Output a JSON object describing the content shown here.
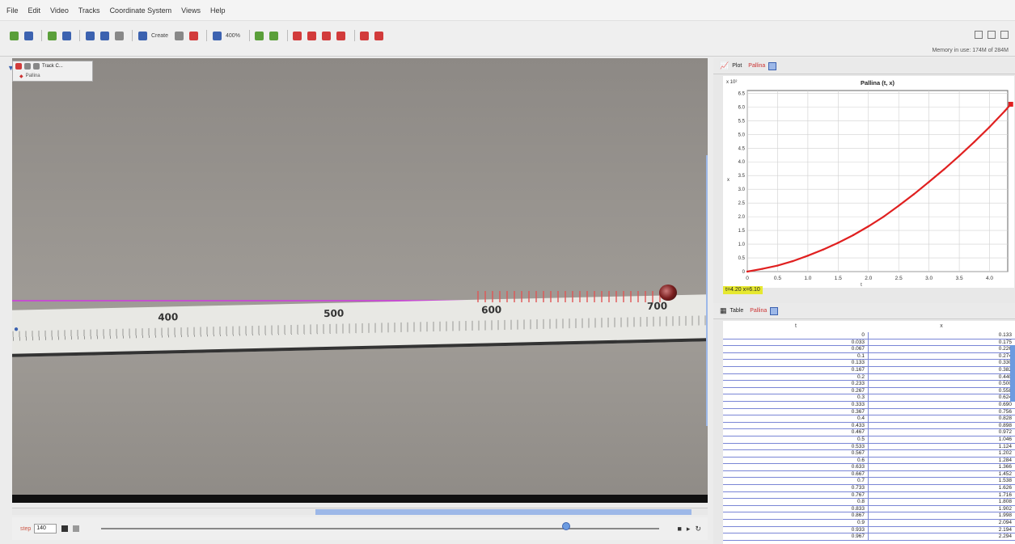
{
  "menubar": [
    "File",
    "Edit",
    "Video",
    "Tracks",
    "Coordinate System",
    "Views",
    "Help"
  ],
  "toolbar": {
    "create_label": "Create",
    "zoom_label": "400%",
    "memory": "Memory in use: 174M of 284M"
  },
  "track_control": {
    "title": "Track C...",
    "item": "Pallina"
  },
  "video": {
    "ruler_numbers": [
      "400",
      "500",
      "600",
      "700"
    ]
  },
  "player": {
    "step_label": "step",
    "frame_value": "140"
  },
  "plot": {
    "tab_label": "Plot",
    "mass_label": "Pallina",
    "readout": "t=4.20  x=6.10"
  },
  "table": {
    "tab_label": "Table",
    "mass_label": "Pallina",
    "col_t": "t",
    "col_x": "x",
    "rows": [
      [
        "0",
        "0.133"
      ],
      [
        "0.033",
        "0.175"
      ],
      [
        "0.067",
        "0.226"
      ],
      [
        "0.1",
        "0.274"
      ],
      [
        "0.133",
        "0.330"
      ],
      [
        "0.167",
        "0.382"
      ],
      [
        "0.2",
        "0.440"
      ],
      [
        "0.233",
        "0.500"
      ],
      [
        "0.267",
        "0.558"
      ],
      [
        "0.3",
        "0.624"
      ],
      [
        "0.333",
        "0.690"
      ],
      [
        "0.367",
        "0.756"
      ],
      [
        "0.4",
        "0.828"
      ],
      [
        "0.433",
        "0.898"
      ],
      [
        "0.467",
        "0.972"
      ],
      [
        "0.5",
        "1.046"
      ],
      [
        "0.533",
        "1.124"
      ],
      [
        "0.567",
        "1.202"
      ],
      [
        "0.6",
        "1.284"
      ],
      [
        "0.633",
        "1.366"
      ],
      [
        "0.667",
        "1.452"
      ],
      [
        "0.7",
        "1.538"
      ],
      [
        "0.733",
        "1.626"
      ],
      [
        "0.767",
        "1.716"
      ],
      [
        "0.8",
        "1.808"
      ],
      [
        "0.833",
        "1.902"
      ],
      [
        "0.867",
        "1.998"
      ],
      [
        "0.9",
        "2.094"
      ],
      [
        "0.933",
        "2.194"
      ],
      [
        "0.967",
        "2.294"
      ]
    ]
  },
  "chart_data": {
    "type": "line",
    "title": "Pallina (t, x)",
    "xlabel": "t",
    "ylabel": "x",
    "y_multiplier_label": "x 10²",
    "xlim": [
      0,
      4.3
    ],
    "ylim": [
      0,
      6.6
    ],
    "x_ticks": [
      "0",
      "0.5",
      "1.0",
      "1.5",
      "2.0",
      "2.5",
      "3.0",
      "3.5",
      "4.0"
    ],
    "y_ticks": [
      "0",
      "0.5",
      "1.0",
      "1.5",
      "2.0",
      "2.5",
      "3.0",
      "3.5",
      "4.0",
      "4.5",
      "5.0",
      "5.5",
      "6.0",
      "6.5"
    ],
    "grid": true,
    "series": [
      {
        "color": "#e02020",
        "x": [
          0,
          0.25,
          0.5,
          0.75,
          1.0,
          1.25,
          1.5,
          1.75,
          2.0,
          2.25,
          2.5,
          2.75,
          3.0,
          3.25,
          3.5,
          3.75,
          4.0,
          4.25,
          4.35
        ],
        "y": [
          0.0,
          0.1,
          0.22,
          0.38,
          0.58,
          0.8,
          1.05,
          1.33,
          1.65,
          2.0,
          2.4,
          2.82,
          3.27,
          3.73,
          4.22,
          4.73,
          5.27,
          5.85,
          6.1
        ]
      }
    ]
  }
}
